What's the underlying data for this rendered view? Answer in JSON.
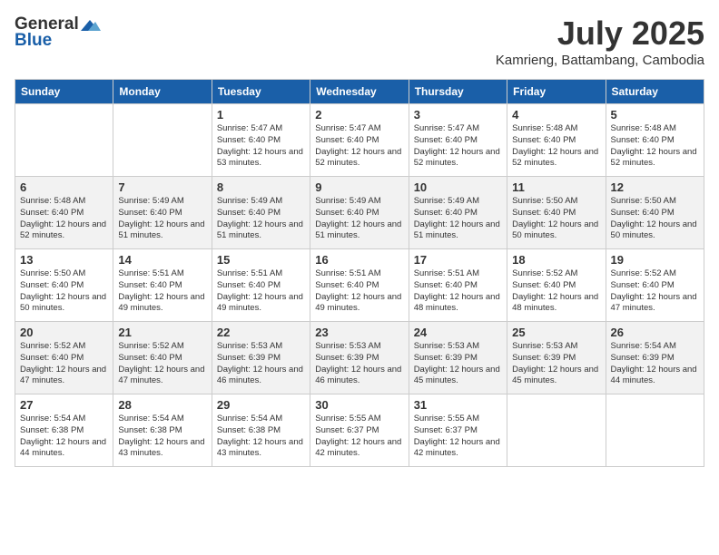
{
  "header": {
    "logo_general": "General",
    "logo_blue": "Blue",
    "title": "July 2025",
    "subtitle": "Kamrieng, Battambang, Cambodia"
  },
  "days_of_week": [
    "Sunday",
    "Monday",
    "Tuesday",
    "Wednesday",
    "Thursday",
    "Friday",
    "Saturday"
  ],
  "weeks": [
    [
      {
        "day": "",
        "sunrise": "",
        "sunset": "",
        "daylight": ""
      },
      {
        "day": "",
        "sunrise": "",
        "sunset": "",
        "daylight": ""
      },
      {
        "day": "1",
        "sunrise": "Sunrise: 5:47 AM",
        "sunset": "Sunset: 6:40 PM",
        "daylight": "Daylight: 12 hours and 53 minutes."
      },
      {
        "day": "2",
        "sunrise": "Sunrise: 5:47 AM",
        "sunset": "Sunset: 6:40 PM",
        "daylight": "Daylight: 12 hours and 52 minutes."
      },
      {
        "day": "3",
        "sunrise": "Sunrise: 5:47 AM",
        "sunset": "Sunset: 6:40 PM",
        "daylight": "Daylight: 12 hours and 52 minutes."
      },
      {
        "day": "4",
        "sunrise": "Sunrise: 5:48 AM",
        "sunset": "Sunset: 6:40 PM",
        "daylight": "Daylight: 12 hours and 52 minutes."
      },
      {
        "day": "5",
        "sunrise": "Sunrise: 5:48 AM",
        "sunset": "Sunset: 6:40 PM",
        "daylight": "Daylight: 12 hours and 52 minutes."
      }
    ],
    [
      {
        "day": "6",
        "sunrise": "Sunrise: 5:48 AM",
        "sunset": "Sunset: 6:40 PM",
        "daylight": "Daylight: 12 hours and 52 minutes."
      },
      {
        "day": "7",
        "sunrise": "Sunrise: 5:49 AM",
        "sunset": "Sunset: 6:40 PM",
        "daylight": "Daylight: 12 hours and 51 minutes."
      },
      {
        "day": "8",
        "sunrise": "Sunrise: 5:49 AM",
        "sunset": "Sunset: 6:40 PM",
        "daylight": "Daylight: 12 hours and 51 minutes."
      },
      {
        "day": "9",
        "sunrise": "Sunrise: 5:49 AM",
        "sunset": "Sunset: 6:40 PM",
        "daylight": "Daylight: 12 hours and 51 minutes."
      },
      {
        "day": "10",
        "sunrise": "Sunrise: 5:49 AM",
        "sunset": "Sunset: 6:40 PM",
        "daylight": "Daylight: 12 hours and 51 minutes."
      },
      {
        "day": "11",
        "sunrise": "Sunrise: 5:50 AM",
        "sunset": "Sunset: 6:40 PM",
        "daylight": "Daylight: 12 hours and 50 minutes."
      },
      {
        "day": "12",
        "sunrise": "Sunrise: 5:50 AM",
        "sunset": "Sunset: 6:40 PM",
        "daylight": "Daylight: 12 hours and 50 minutes."
      }
    ],
    [
      {
        "day": "13",
        "sunrise": "Sunrise: 5:50 AM",
        "sunset": "Sunset: 6:40 PM",
        "daylight": "Daylight: 12 hours and 50 minutes."
      },
      {
        "day": "14",
        "sunrise": "Sunrise: 5:51 AM",
        "sunset": "Sunset: 6:40 PM",
        "daylight": "Daylight: 12 hours and 49 minutes."
      },
      {
        "day": "15",
        "sunrise": "Sunrise: 5:51 AM",
        "sunset": "Sunset: 6:40 PM",
        "daylight": "Daylight: 12 hours and 49 minutes."
      },
      {
        "day": "16",
        "sunrise": "Sunrise: 5:51 AM",
        "sunset": "Sunset: 6:40 PM",
        "daylight": "Daylight: 12 hours and 49 minutes."
      },
      {
        "day": "17",
        "sunrise": "Sunrise: 5:51 AM",
        "sunset": "Sunset: 6:40 PM",
        "daylight": "Daylight: 12 hours and 48 minutes."
      },
      {
        "day": "18",
        "sunrise": "Sunrise: 5:52 AM",
        "sunset": "Sunset: 6:40 PM",
        "daylight": "Daylight: 12 hours and 48 minutes."
      },
      {
        "day": "19",
        "sunrise": "Sunrise: 5:52 AM",
        "sunset": "Sunset: 6:40 PM",
        "daylight": "Daylight: 12 hours and 47 minutes."
      }
    ],
    [
      {
        "day": "20",
        "sunrise": "Sunrise: 5:52 AM",
        "sunset": "Sunset: 6:40 PM",
        "daylight": "Daylight: 12 hours and 47 minutes."
      },
      {
        "day": "21",
        "sunrise": "Sunrise: 5:52 AM",
        "sunset": "Sunset: 6:40 PM",
        "daylight": "Daylight: 12 hours and 47 minutes."
      },
      {
        "day": "22",
        "sunrise": "Sunrise: 5:53 AM",
        "sunset": "Sunset: 6:39 PM",
        "daylight": "Daylight: 12 hours and 46 minutes."
      },
      {
        "day": "23",
        "sunrise": "Sunrise: 5:53 AM",
        "sunset": "Sunset: 6:39 PM",
        "daylight": "Daylight: 12 hours and 46 minutes."
      },
      {
        "day": "24",
        "sunrise": "Sunrise: 5:53 AM",
        "sunset": "Sunset: 6:39 PM",
        "daylight": "Daylight: 12 hours and 45 minutes."
      },
      {
        "day": "25",
        "sunrise": "Sunrise: 5:53 AM",
        "sunset": "Sunset: 6:39 PM",
        "daylight": "Daylight: 12 hours and 45 minutes."
      },
      {
        "day": "26",
        "sunrise": "Sunrise: 5:54 AM",
        "sunset": "Sunset: 6:39 PM",
        "daylight": "Daylight: 12 hours and 44 minutes."
      }
    ],
    [
      {
        "day": "27",
        "sunrise": "Sunrise: 5:54 AM",
        "sunset": "Sunset: 6:38 PM",
        "daylight": "Daylight: 12 hours and 44 minutes."
      },
      {
        "day": "28",
        "sunrise": "Sunrise: 5:54 AM",
        "sunset": "Sunset: 6:38 PM",
        "daylight": "Daylight: 12 hours and 43 minutes."
      },
      {
        "day": "29",
        "sunrise": "Sunrise: 5:54 AM",
        "sunset": "Sunset: 6:38 PM",
        "daylight": "Daylight: 12 hours and 43 minutes."
      },
      {
        "day": "30",
        "sunrise": "Sunrise: 5:55 AM",
        "sunset": "Sunset: 6:37 PM",
        "daylight": "Daylight: 12 hours and 42 minutes."
      },
      {
        "day": "31",
        "sunrise": "Sunrise: 5:55 AM",
        "sunset": "Sunset: 6:37 PM",
        "daylight": "Daylight: 12 hours and 42 minutes."
      },
      {
        "day": "",
        "sunrise": "",
        "sunset": "",
        "daylight": ""
      },
      {
        "day": "",
        "sunrise": "",
        "sunset": "",
        "daylight": ""
      }
    ]
  ]
}
